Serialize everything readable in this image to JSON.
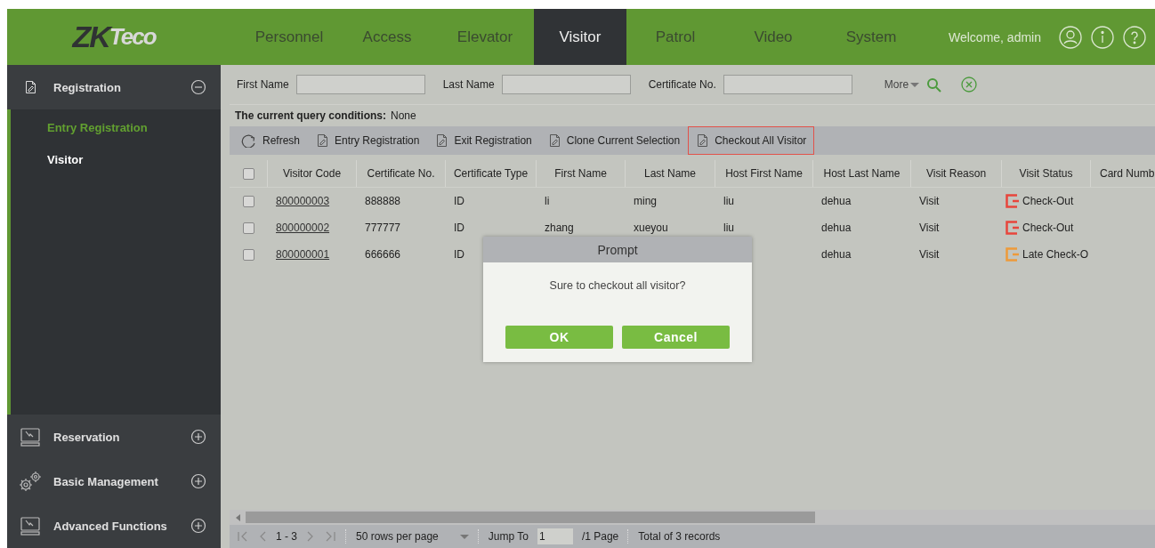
{
  "header": {
    "logo": {
      "part_1": "ZK",
      "part_2": "Teco"
    },
    "tabs": [
      {
        "label": "Personnel",
        "selected": false
      },
      {
        "label": "Access",
        "selected": false
      },
      {
        "label": "Elevator",
        "selected": false
      },
      {
        "label": "Visitor",
        "selected": true
      },
      {
        "label": "Patrol",
        "selected": false
      },
      {
        "label": "Video",
        "selected": false
      },
      {
        "label": "System",
        "selected": false
      }
    ],
    "welcome": "Welcome, admin"
  },
  "sidebar": {
    "groups": [
      {
        "label": "Registration",
        "kind": "document",
        "expanded": true,
        "items": [
          {
            "label": "Entry Registration",
            "selected": true
          },
          {
            "label": "Visitor",
            "selected": false
          }
        ]
      },
      {
        "label": "Reservation",
        "kind": "monitor",
        "expanded": false
      },
      {
        "label": "Basic Management",
        "kind": "gears",
        "expanded": false
      },
      {
        "label": "Advanced Functions",
        "kind": "monitor",
        "expanded": false
      }
    ]
  },
  "filters": {
    "fields": [
      {
        "label": "First Name"
      },
      {
        "label": "Last Name"
      },
      {
        "label": "Certificate No."
      }
    ],
    "more": "More"
  },
  "query_conditions": {
    "label": "The current query conditions:",
    "value": "None"
  },
  "toolbar": [
    {
      "label": "Refresh",
      "kind": "refresh",
      "highlighted": false
    },
    {
      "label": "Entry Registration",
      "kind": "document",
      "highlighted": false
    },
    {
      "label": "Exit Registration",
      "kind": "document",
      "highlighted": false
    },
    {
      "label": "Clone Current Selection",
      "kind": "document",
      "highlighted": false
    },
    {
      "label": "Checkout All Visitor",
      "kind": "document",
      "highlighted": true
    }
  ],
  "table": {
    "all_checked": false,
    "columns": [
      "Visitor Code",
      "Certificate No.",
      "Certificate Type",
      "First Name",
      "Last Name",
      "Host First Name",
      "Host Last Name",
      "Visit Reason",
      "Visit Status",
      "Card Numb"
    ],
    "rows": [
      {
        "checked": false,
        "visitor_code": "800000003",
        "certificate_no": "888888",
        "certificate_type": "ID",
        "first_name": "li",
        "last_name": "ming",
        "host_first_name": "liu",
        "host_last_name": "dehua",
        "visit_reason": "Visit",
        "visit_status": "Check-Out",
        "color": "#e8453c"
      },
      {
        "checked": false,
        "visitor_code": "800000002",
        "certificate_no": "777777",
        "certificate_type": "ID",
        "first_name": "zhang",
        "last_name": "xueyou",
        "host_first_name": "liu",
        "host_last_name": "dehua",
        "visit_reason": "Visit",
        "visit_status": "Check-Out",
        "color": "#e8453c"
      },
      {
        "checked": false,
        "visitor_code": "800000001",
        "certificate_no": "666666",
        "certificate_type": "ID",
        "host_last_name": "dehua",
        "visit_reason": "Visit",
        "visit_status": "Late Check-O",
        "color": "#ee9a3a"
      }
    ]
  },
  "pagination": {
    "range": "1 - 3",
    "rows_per_page": "50 rows per page",
    "jump_to": "Jump To",
    "page_value": "1",
    "pages": "/1 Page",
    "total": "Total of 3 records"
  },
  "dialog": {
    "title": "Prompt",
    "message": "Sure to checkout all visitor?",
    "buttons": [
      "OK",
      "Cancel"
    ]
  }
}
